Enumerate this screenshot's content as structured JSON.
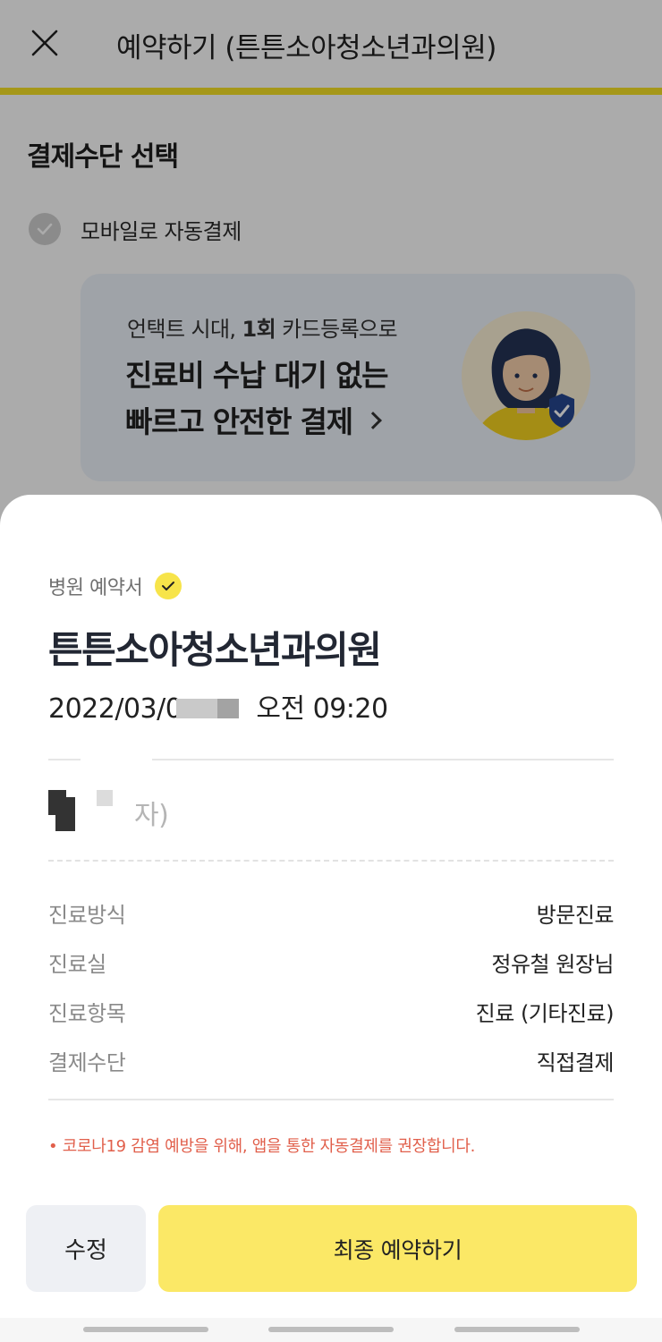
{
  "header": {
    "title": "예약하기 (튼튼소아청소년과의원)",
    "close_icon": "close-icon"
  },
  "payment": {
    "section_title": "결제수단 선택",
    "option_label": "모바일로 자동결제",
    "option_icon": "check-circle-icon"
  },
  "promo": {
    "sub_prefix": "언택트 시대, ",
    "sub_bold": "1회",
    "sub_suffix": " 카드등록으로",
    "main_line1": "진료비 수납 대기 없는",
    "main_line2": "빠르고 안전한 결제",
    "icons": [
      "chevron-right-icon",
      "woman-avatar-illustration",
      "shield-check-icon"
    ]
  },
  "sheet": {
    "label": "병원 예약서",
    "label_icon": "yellow-check-icon",
    "hospital_name": "튼튼소아청소년과의원",
    "date_visible": "2022/03/0",
    "time": "오전 09:20",
    "patient_visible_suffix": "자)",
    "info": [
      {
        "key": "진료방식",
        "value": "방문진료"
      },
      {
        "key": "진료실",
        "value": "정유철 원장님"
      },
      {
        "key": "진료항목",
        "value": "진료 (기타진료)"
      },
      {
        "key": "결제수단",
        "value": "직접결제"
      }
    ],
    "notice": "• 코로나19 감염 예방을 위해, 앱을 통한 자동결제를 권장합니다.",
    "edit_button": "수정",
    "confirm_button": "최종 예약하기"
  },
  "colors": {
    "brand_yellow": "#fbe866",
    "accent_line": "#f6e226",
    "notice_red": "#e15f4b",
    "edit_button_bg": "#eef0f4",
    "promo_bg": "#eef3fb"
  }
}
